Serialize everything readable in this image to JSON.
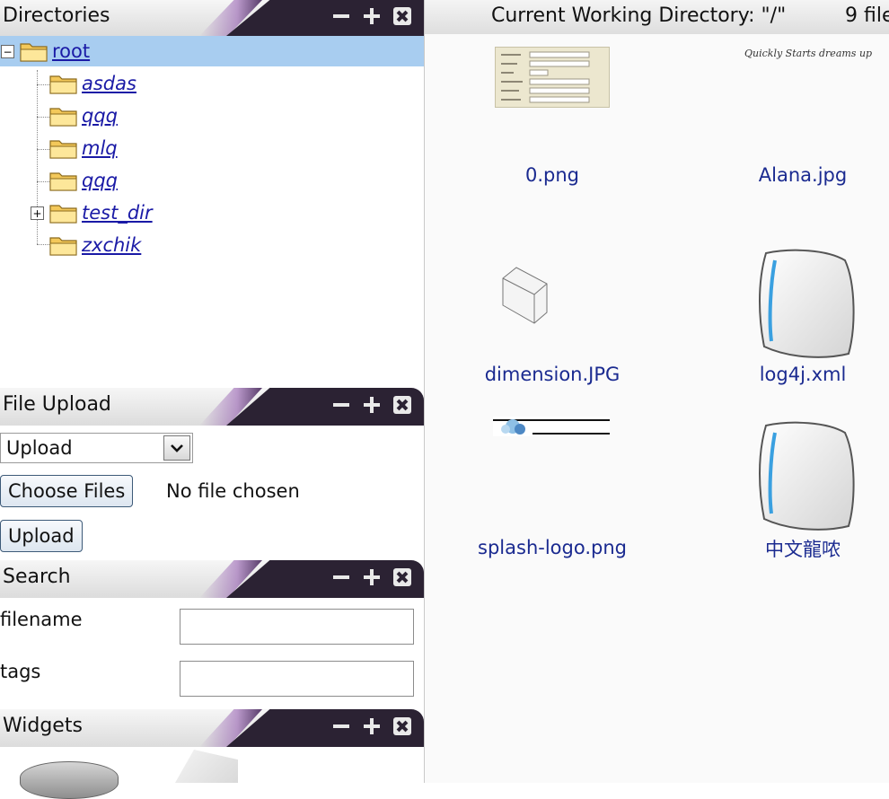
{
  "directories_panel": {
    "title": "Directories",
    "tree": {
      "root": "root",
      "children": [
        "asdas",
        "qqq",
        "mlq",
        "qqq",
        "test_dir",
        "zxchik"
      ]
    }
  },
  "upload_panel": {
    "title": "File Upload",
    "mode_select": "Upload",
    "choose_files_label": "Choose Files",
    "no_file_text": "No file chosen",
    "upload_button": "Upload"
  },
  "search_panel": {
    "title": "Search",
    "filename_label": "filename",
    "tags_label": "tags",
    "filename_value": "",
    "tags_value": ""
  },
  "widgets_panel": {
    "title": "Widgets"
  },
  "main": {
    "cwd_label": "Current Working Directory: \"/\"",
    "file_count": "9 file",
    "files": [
      "0.png",
      "Alana.jpg",
      "dimension.JPG",
      "log4j.xml",
      "splash-logo.png",
      "中文龍哝"
    ],
    "alana_caption": "Quickly Starts dreams up"
  },
  "icons": {
    "folder": "folder-icon",
    "expander_minus": "minus-box-icon",
    "expander_plus": "plus-box-icon",
    "minimize": "minimize-icon",
    "maximize": "maximize-icon",
    "close": "close-icon",
    "dropdown": "chevron-down-icon",
    "document": "document-icon",
    "box": "box-icon"
  },
  "colors": {
    "link": "#1a1aa6",
    "file_label": "#1a2a90",
    "selection": "#a8cdf0",
    "header_dark": "#2b2233"
  }
}
